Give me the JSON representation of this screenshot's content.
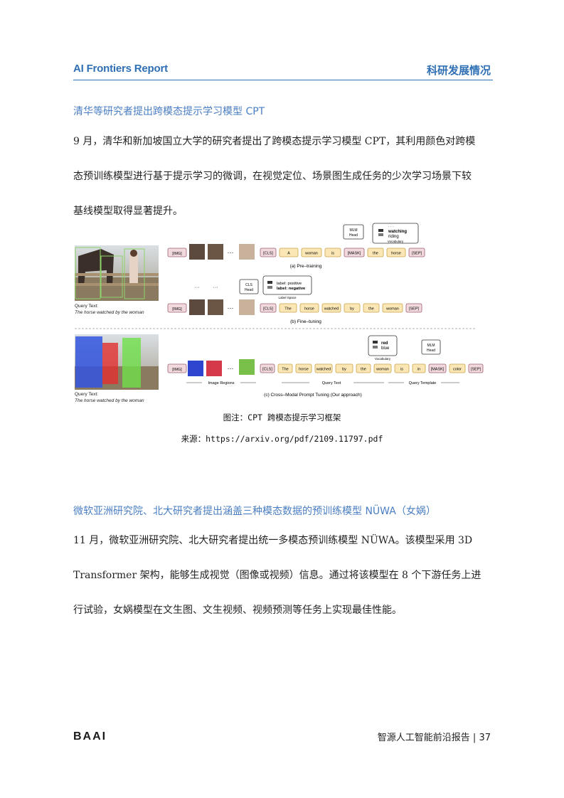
{
  "header": {
    "left_title": "AI Frontiers Report",
    "right_title": "科研发展情况"
  },
  "section1": {
    "heading": "清华等研究者提出跨模态提示学习模型 CPT",
    "lines": [
      "9 月，清华和新加坡国立大学的研究者提出了跨模态提示学习模型 CPT，其利用颜色对跨模",
      "态预训练模型进行基于提示学习的微调，在视觉定位、场景图生成任务的少次学习场景下较",
      "基线模型取得显著提升。"
    ]
  },
  "figure": {
    "query_text_label": "Query Text:",
    "query_text_value": "The horse watched by the woman",
    "row_a": {
      "tokens": [
        "[IMG]",
        "[CLS]",
        "A",
        "woman",
        "is",
        "[MASK]",
        "the",
        "horse",
        "[SEP]"
      ],
      "head": "MLM Head",
      "vocab": [
        "watching",
        "riding"
      ],
      "vocab_label": "Vocabulary",
      "vocab_dots": "· · ·",
      "caption": "(a) Pre–training"
    },
    "row_b": {
      "tokens": [
        "[IMG]",
        "[CLS]",
        "The",
        "horse",
        "watched",
        "by",
        "the",
        "woman",
        "[SEP]"
      ],
      "head": "CLS Head",
      "labels": [
        "label: positive",
        "label: negative"
      ],
      "label_space": "Label Space",
      "caption": "(b) Fine–tuning"
    },
    "row_c": {
      "tokens": [
        "[IMG]",
        "[CLS]",
        "The",
        "horse",
        "watched",
        "by",
        "the",
        "woman",
        "is",
        "in",
        "[MASK]",
        "color",
        "[SEP]"
      ],
      "head": "MLM Head",
      "vocab": [
        "red",
        "blue"
      ],
      "vocab_label": "Vocabulary",
      "image_regions": "Image Regions",
      "query_text": "Query Text",
      "query_template": "Query Template",
      "caption": "(c) Cross–Modal Prompt Tuning (Our approach)"
    },
    "ellipsis": "···",
    "caption_line": "图注：CPT 跨模态提示学习框架",
    "source_line": "来源：https://arxiv.org/pdf/2109.11797.pdf"
  },
  "section2": {
    "heading": "微软亚洲研究院、北大研究者提出涵盖三种模态数据的预训练模型 NÜWA（女娲）",
    "lines": [
      "11 月，微软亚洲研究院、北大研究者提出统一多模态预训练模型 NÜWA。该模型采用 3D",
      "Transformer 架构，能够生成视觉（图像或视频）信息。通过将该模型在 8 个下游任务上进",
      "行试验，女娲模型在文生图、文生视频、视频预测等任务上实现最佳性能。"
    ]
  },
  "footer": {
    "logo": "BAAI",
    "report_name": "智源人工智能前沿报告",
    "separator": "|",
    "page_number": "37"
  },
  "colors": {
    "accent": "#2f6fb3",
    "heading": "#4a7ec2",
    "token_fill": "#fbe7b5",
    "token_stroke": "#c9a24a",
    "special_fill": "#f2d9de",
    "special_stroke": "#9a6070"
  }
}
